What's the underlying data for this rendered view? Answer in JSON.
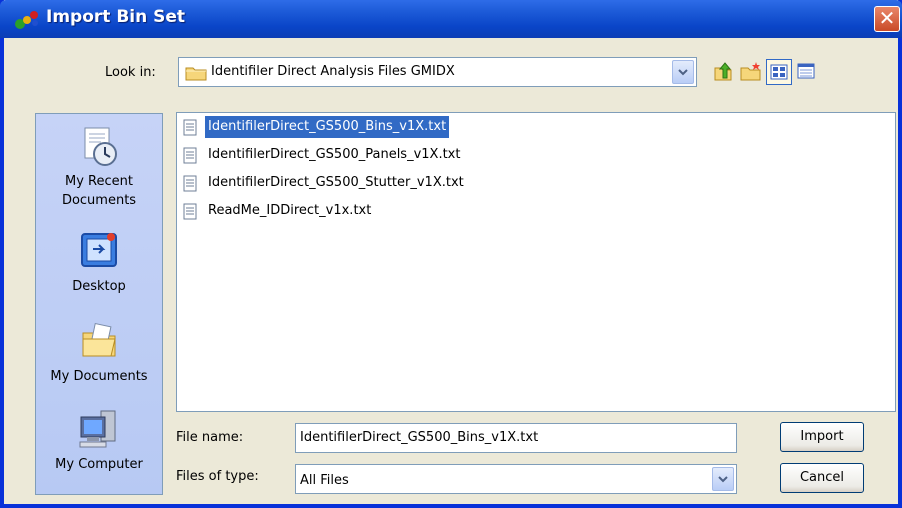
{
  "window": {
    "title": "Import Bin Set",
    "close_label": "✕"
  },
  "lookin": {
    "label": "Look in:",
    "value": "Identifiler Direct Analysis Files GMIDX"
  },
  "places": [
    {
      "label_line1": "My Recent",
      "label_line2": "Documents"
    },
    {
      "label_line1": "Desktop"
    },
    {
      "label_line1": "My Documents"
    },
    {
      "label_line1": "My Computer"
    }
  ],
  "files": [
    {
      "name": "IdentifilerDirect_GS500_Bins_v1X.txt",
      "selected": true
    },
    {
      "name": "IdentifilerDirect_GS500_Panels_v1X.txt"
    },
    {
      "name": "IdentifilerDirect_GS500_Stutter_v1X.txt"
    },
    {
      "name": "ReadMe_IDDirect_v1x.txt"
    }
  ],
  "filename": {
    "label": "File name:",
    "value": "IdentifilerDirect_GS500_Bins_v1X.txt"
  },
  "filetype": {
    "label": "Files of type:",
    "value": "All Files"
  },
  "buttons": {
    "import": "Import",
    "cancel": "Cancel"
  },
  "toolbar_icons": [
    "up-folder-icon",
    "new-folder-icon",
    "views-icon",
    "details-icon"
  ]
}
